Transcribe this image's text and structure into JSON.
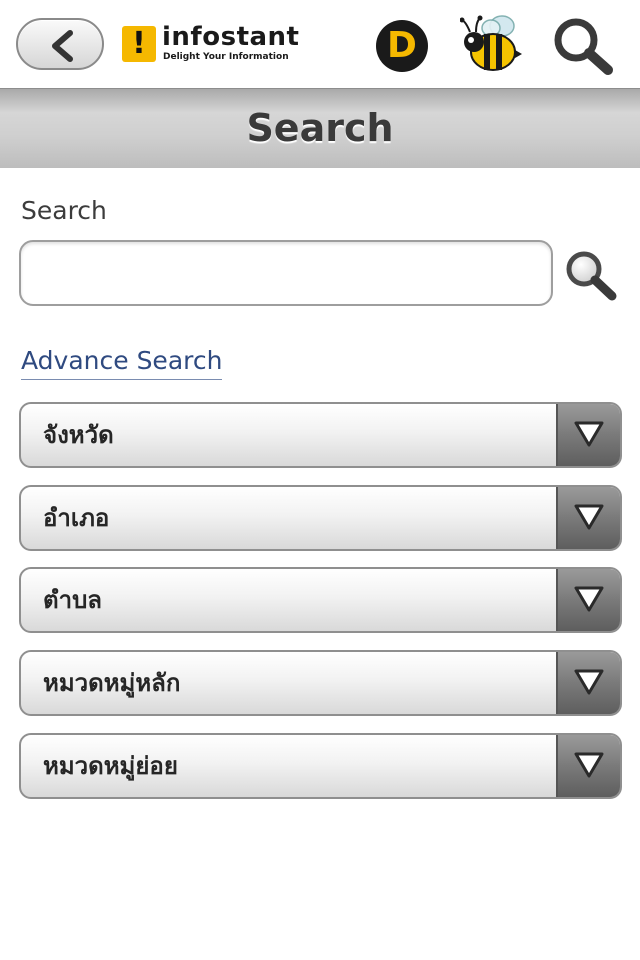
{
  "header": {
    "logo_name": "infostant",
    "logo_tagline": "Delight Your Information",
    "d_badge": "D"
  },
  "title": "Search",
  "search": {
    "label": "Search",
    "value": "",
    "placeholder": ""
  },
  "advance_link": "Advance Search",
  "dropdowns": [
    {
      "label": "จังหวัด"
    },
    {
      "label": "อำเภอ"
    },
    {
      "label": "ตำบล"
    },
    {
      "label": "หมวดหมู่หลัก"
    },
    {
      "label": "หมวดหมู่ย่อย"
    }
  ],
  "colors": {
    "accent_yellow": "#f5b800",
    "link_blue": "#2f4a80",
    "title_bar_gray": "#cfcfcf",
    "dropdown_button_gray": "#7a7a7a"
  },
  "icons": {
    "back": "chevron-left-icon",
    "logo": "exclamation-logo-icon",
    "d": "d-badge-icon",
    "bee": "bee-icon",
    "search": "magnifier-icon",
    "dropdown": "triangle-down-icon"
  }
}
